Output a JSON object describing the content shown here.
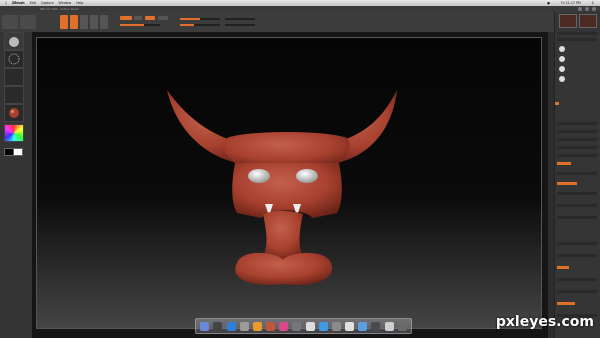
{
  "menubar": {
    "app": "ZBrush",
    "items": [
      "Edit",
      "Capture",
      "Window",
      "Help"
    ],
    "clock": "Fri 21:17 PM"
  },
  "window_title": "ZBrush 4R4 - Active Mesh",
  "watermark": "pxleyes.com",
  "colors": {
    "accent": "#e0702a",
    "model": "#a8412f",
    "eyes": "#e6e6e6"
  },
  "dock_icon_colors": [
    "#6b8ad6",
    "#444",
    "#2f7fd8",
    "#9a9a9a",
    "#e89a2a",
    "#c2563b",
    "#d84a8a",
    "#777",
    "#ddd",
    "#3f9ae6",
    "#8a8a8a",
    "#e0e0e0",
    "#5aa0e0",
    "#4a4a4a",
    "#cfcfcf",
    "#6a6a6a"
  ]
}
